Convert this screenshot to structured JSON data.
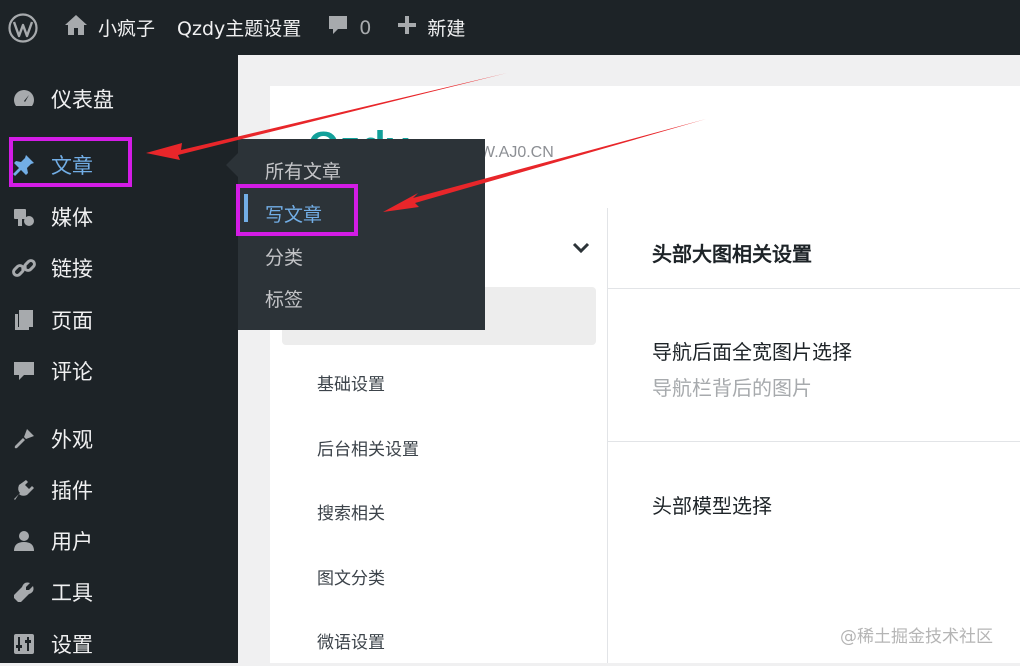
{
  "admin_bar": {
    "site_name": "小疯子",
    "theme_settings": "Qzdy主题设置",
    "comment_count": "0",
    "new_label": "新建"
  },
  "sidebar": {
    "items": [
      {
        "label": "仪表盘",
        "icon": "dashboard-icon"
      },
      {
        "label": "文章",
        "icon": "pushpin-icon",
        "active": true
      },
      {
        "label": "媒体",
        "icon": "media-icon"
      },
      {
        "label": "链接",
        "icon": "link-icon"
      },
      {
        "label": "页面",
        "icon": "pages-icon"
      },
      {
        "label": "评论",
        "icon": "comment-icon"
      },
      {
        "label": "外观",
        "icon": "appearance-icon"
      },
      {
        "label": "插件",
        "icon": "plugin-icon"
      },
      {
        "label": "用户",
        "icon": "user-icon"
      },
      {
        "label": "工具",
        "icon": "wrench-icon"
      },
      {
        "label": "设置",
        "icon": "settings-icon"
      }
    ]
  },
  "flyout": {
    "items": [
      "所有文章",
      "写文章",
      "分类",
      "标签"
    ],
    "current": "写文章"
  },
  "header": {
    "logo": "Qzdy",
    "url": "W.AJ0.CN"
  },
  "settings_nav": {
    "items": [
      "基础设置",
      "后台相关设置",
      "搜索相关",
      "图文分类",
      "微语设置"
    ]
  },
  "settings_main": {
    "section_title": "头部大图相关设置",
    "fields": [
      {
        "label": "导航后面全宽图片选择",
        "desc": "导航栏背后的图片"
      },
      {
        "label": "头部模型选择"
      }
    ]
  },
  "colors": {
    "admin_bg": "#1d2327",
    "active_blue": "#72aee6",
    "highlight": "#d31ce6",
    "arrow_red": "#e8262a",
    "brand_teal": "#12a09a"
  },
  "watermark": "@稀土掘金技术社区"
}
